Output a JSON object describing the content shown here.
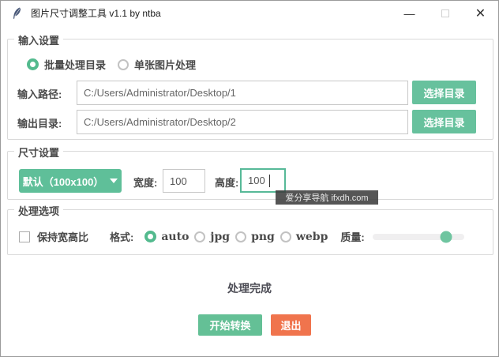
{
  "window": {
    "title": "图片尺寸调整工具 v1.1 by ntba",
    "controls": {
      "minimize": "—",
      "close": "✕"
    }
  },
  "input_section": {
    "legend": "输入设置",
    "mode_options": [
      {
        "label": "批量处理目录",
        "selected": true
      },
      {
        "label": "单张图片处理",
        "selected": false
      }
    ],
    "input_path": {
      "label": "输入路径:",
      "value": "C:/Users/Administrator/Desktop/1",
      "button": "选择目录"
    },
    "output_dir": {
      "label": "输出目录:",
      "value": "C:/Users/Administrator/Desktop/2",
      "button": "选择目录"
    }
  },
  "size_section": {
    "legend": "尺寸设置",
    "preset_dropdown": {
      "value": "默认（100x100）"
    },
    "width": {
      "label": "宽度:",
      "value": "100"
    },
    "height": {
      "label": "高度:",
      "value": "100",
      "focused": true
    }
  },
  "options_section": {
    "legend": "处理选项",
    "keep_ratio": {
      "label": "保持宽高比",
      "checked": false
    },
    "format": {
      "label": "格式:",
      "options": [
        {
          "label": "auto",
          "selected": true
        },
        {
          "label": "jpg",
          "selected": false
        },
        {
          "label": "png",
          "selected": false
        },
        {
          "label": "webp",
          "selected": false
        }
      ]
    },
    "quality": {
      "label": "质量:",
      "thumb_position_percent": 80
    }
  },
  "status_text": "处理完成",
  "actions": {
    "start": "开始转换",
    "exit": "退出"
  },
  "watermark": {
    "text": "爱分享导航 ifxdh.com"
  },
  "colors": {
    "green": "#64c096",
    "orange": "#f0744d",
    "focus_green": "#57b998"
  }
}
